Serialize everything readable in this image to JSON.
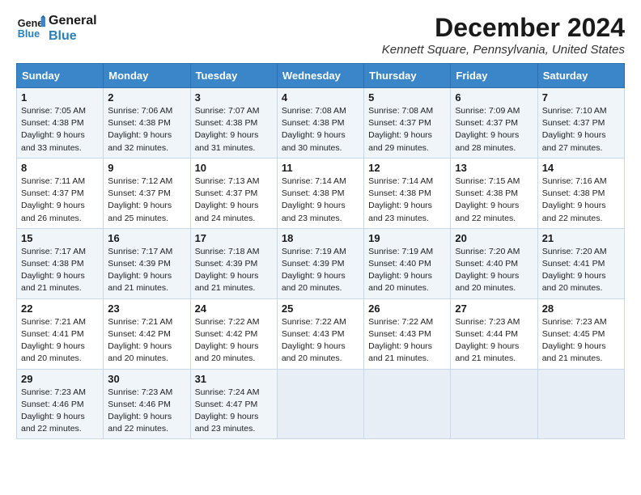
{
  "logo": {
    "line1": "General",
    "line2": "Blue"
  },
  "title": "December 2024",
  "location": "Kennett Square, Pennsylvania, United States",
  "days_of_week": [
    "Sunday",
    "Monday",
    "Tuesday",
    "Wednesday",
    "Thursday",
    "Friday",
    "Saturday"
  ],
  "weeks": [
    [
      {
        "day": "1",
        "sunrise": "7:05 AM",
        "sunset": "4:38 PM",
        "daylight": "9 hours and 33 minutes."
      },
      {
        "day": "2",
        "sunrise": "7:06 AM",
        "sunset": "4:38 PM",
        "daylight": "9 hours and 32 minutes."
      },
      {
        "day": "3",
        "sunrise": "7:07 AM",
        "sunset": "4:38 PM",
        "daylight": "9 hours and 31 minutes."
      },
      {
        "day": "4",
        "sunrise": "7:08 AM",
        "sunset": "4:38 PM",
        "daylight": "9 hours and 30 minutes."
      },
      {
        "day": "5",
        "sunrise": "7:08 AM",
        "sunset": "4:37 PM",
        "daylight": "9 hours and 29 minutes."
      },
      {
        "day": "6",
        "sunrise": "7:09 AM",
        "sunset": "4:37 PM",
        "daylight": "9 hours and 28 minutes."
      },
      {
        "day": "7",
        "sunrise": "7:10 AM",
        "sunset": "4:37 PM",
        "daylight": "9 hours and 27 minutes."
      }
    ],
    [
      {
        "day": "8",
        "sunrise": "7:11 AM",
        "sunset": "4:37 PM",
        "daylight": "9 hours and 26 minutes."
      },
      {
        "day": "9",
        "sunrise": "7:12 AM",
        "sunset": "4:37 PM",
        "daylight": "9 hours and 25 minutes."
      },
      {
        "day": "10",
        "sunrise": "7:13 AM",
        "sunset": "4:37 PM",
        "daylight": "9 hours and 24 minutes."
      },
      {
        "day": "11",
        "sunrise": "7:14 AM",
        "sunset": "4:38 PM",
        "daylight": "9 hours and 23 minutes."
      },
      {
        "day": "12",
        "sunrise": "7:14 AM",
        "sunset": "4:38 PM",
        "daylight": "9 hours and 23 minutes."
      },
      {
        "day": "13",
        "sunrise": "7:15 AM",
        "sunset": "4:38 PM",
        "daylight": "9 hours and 22 minutes."
      },
      {
        "day": "14",
        "sunrise": "7:16 AM",
        "sunset": "4:38 PM",
        "daylight": "9 hours and 22 minutes."
      }
    ],
    [
      {
        "day": "15",
        "sunrise": "7:17 AM",
        "sunset": "4:38 PM",
        "daylight": "9 hours and 21 minutes."
      },
      {
        "day": "16",
        "sunrise": "7:17 AM",
        "sunset": "4:39 PM",
        "daylight": "9 hours and 21 minutes."
      },
      {
        "day": "17",
        "sunrise": "7:18 AM",
        "sunset": "4:39 PM",
        "daylight": "9 hours and 21 minutes."
      },
      {
        "day": "18",
        "sunrise": "7:19 AM",
        "sunset": "4:39 PM",
        "daylight": "9 hours and 20 minutes."
      },
      {
        "day": "19",
        "sunrise": "7:19 AM",
        "sunset": "4:40 PM",
        "daylight": "9 hours and 20 minutes."
      },
      {
        "day": "20",
        "sunrise": "7:20 AM",
        "sunset": "4:40 PM",
        "daylight": "9 hours and 20 minutes."
      },
      {
        "day": "21",
        "sunrise": "7:20 AM",
        "sunset": "4:41 PM",
        "daylight": "9 hours and 20 minutes."
      }
    ],
    [
      {
        "day": "22",
        "sunrise": "7:21 AM",
        "sunset": "4:41 PM",
        "daylight": "9 hours and 20 minutes."
      },
      {
        "day": "23",
        "sunrise": "7:21 AM",
        "sunset": "4:42 PM",
        "daylight": "9 hours and 20 minutes."
      },
      {
        "day": "24",
        "sunrise": "7:22 AM",
        "sunset": "4:42 PM",
        "daylight": "9 hours and 20 minutes."
      },
      {
        "day": "25",
        "sunrise": "7:22 AM",
        "sunset": "4:43 PM",
        "daylight": "9 hours and 20 minutes."
      },
      {
        "day": "26",
        "sunrise": "7:22 AM",
        "sunset": "4:43 PM",
        "daylight": "9 hours and 21 minutes."
      },
      {
        "day": "27",
        "sunrise": "7:23 AM",
        "sunset": "4:44 PM",
        "daylight": "9 hours and 21 minutes."
      },
      {
        "day": "28",
        "sunrise": "7:23 AM",
        "sunset": "4:45 PM",
        "daylight": "9 hours and 21 minutes."
      }
    ],
    [
      {
        "day": "29",
        "sunrise": "7:23 AM",
        "sunset": "4:46 PM",
        "daylight": "9 hours and 22 minutes."
      },
      {
        "day": "30",
        "sunrise": "7:23 AM",
        "sunset": "4:46 PM",
        "daylight": "9 hours and 22 minutes."
      },
      {
        "day": "31",
        "sunrise": "7:24 AM",
        "sunset": "4:47 PM",
        "daylight": "9 hours and 23 minutes."
      },
      null,
      null,
      null,
      null
    ]
  ]
}
